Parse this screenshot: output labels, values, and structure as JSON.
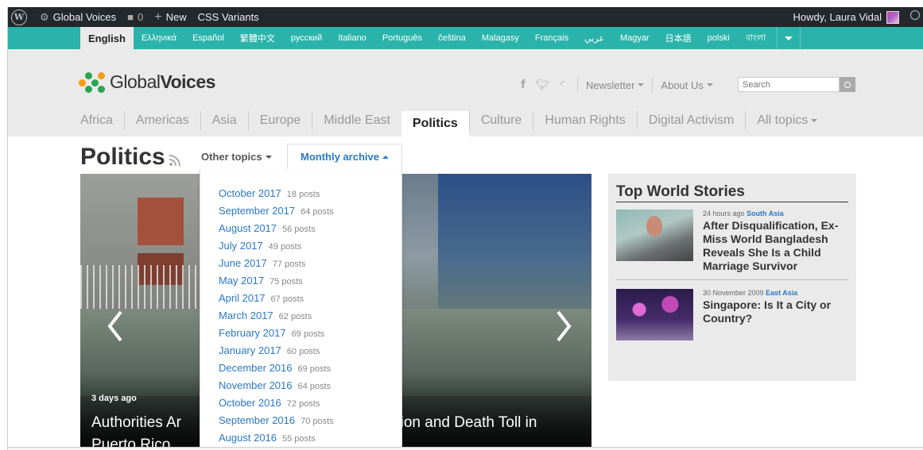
{
  "admin_bar": {
    "site_name": "Global Voices",
    "comments_count": "0",
    "new_label": "New",
    "variants_label": "CSS Variants",
    "howdy": "Howdy, Laura Vidal"
  },
  "languages": [
    {
      "label": "English",
      "active": true
    },
    {
      "label": "Ελληνικά"
    },
    {
      "label": "Español"
    },
    {
      "label": "繁體中文"
    },
    {
      "label": "русский"
    },
    {
      "label": "Italiano"
    },
    {
      "label": "Português"
    },
    {
      "label": "čeština"
    },
    {
      "label": "Malagasy"
    },
    {
      "label": "Français"
    },
    {
      "label": "عربي"
    },
    {
      "label": "Magyar"
    },
    {
      "label": "日本語"
    },
    {
      "label": "polski"
    },
    {
      "label": "বাংলা"
    }
  ],
  "header": {
    "logo_light": "Global",
    "logo_bold": "Voices",
    "newsletter": "Newsletter",
    "about": "About Us",
    "search_placeholder": "Search"
  },
  "topics": [
    {
      "label": "Africa"
    },
    {
      "label": "Americas"
    },
    {
      "label": "Asia"
    },
    {
      "label": "Europe"
    },
    {
      "label": "Middle East"
    },
    {
      "label": "Politics",
      "active": true
    },
    {
      "label": "Culture"
    },
    {
      "label": "Human Rights"
    },
    {
      "label": "Digital Activism"
    },
    {
      "label": "All topics",
      "dropdown": true
    }
  ],
  "page": {
    "title": "Politics",
    "other_topics": "Other topics",
    "monthly_archive": "Monthly archive"
  },
  "archive": [
    {
      "month": "October 2017",
      "count": "18 posts"
    },
    {
      "month": "September 2017",
      "count": "64 posts"
    },
    {
      "month": "August 2017",
      "count": "56 posts"
    },
    {
      "month": "July 2017",
      "count": "49 posts"
    },
    {
      "month": "June 2017",
      "count": "77 posts"
    },
    {
      "month": "May 2017",
      "count": "75 posts"
    },
    {
      "month": "April 2017",
      "count": "67 posts"
    },
    {
      "month": "March 2017",
      "count": "62 posts"
    },
    {
      "month": "February 2017",
      "count": "69 posts"
    },
    {
      "month": "January 2017",
      "count": "60 posts"
    },
    {
      "month": "December 2016",
      "count": "69 posts"
    },
    {
      "month": "November 2016",
      "count": "64 posts"
    },
    {
      "month": "October 2016",
      "count": "72 posts"
    },
    {
      "month": "September 2016",
      "count": "70 posts"
    },
    {
      "month": "August 2016",
      "count": "55 posts"
    }
  ],
  "hero": {
    "time_ago": "3 days ago",
    "headline_left": "Authorities Ar",
    "headline_right": "station and Death Toll in",
    "headline_line2": "Puerto Rico"
  },
  "top_world": {
    "title": "Top World Stories",
    "stories": [
      {
        "time": "24 hours ago",
        "region": "South Asia",
        "title": "After Disqualification, Ex-Miss World Bangladesh Reveals She Is a Child Marriage Survivor"
      },
      {
        "time": "30 November 2009",
        "region": "East Asia",
        "title": "Singapore: Is It a City or Country?"
      }
    ]
  }
}
